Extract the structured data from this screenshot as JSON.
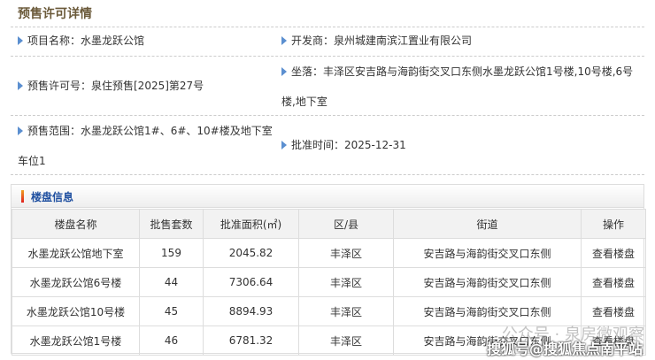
{
  "title": "预售许可详情",
  "fields": {
    "project": "项目名称：水墨龙跃公馆",
    "developer": "开发商：泉州城建南滨江置业有限公司",
    "permit": "预售许可号：泉住预售[2025]第27号",
    "location": "坐落：丰泽区安吉路与海韵街交叉口东侧水墨龙跃公馆1号楼,10号楼,6号楼,地下室",
    "scope": "预售范围：水墨龙跃公馆1#、6#、10#楼及地下室车位1",
    "approval": "批准时间：2025-12-31"
  },
  "panel_title": "楼盘信息",
  "headers": [
    "楼盘名称",
    "批售套数",
    "批准面积(㎡)",
    "区/县",
    "街道",
    "操作"
  ],
  "rows": [
    [
      "水墨龙跃公馆地下室",
      "159",
      "2045.82",
      "丰泽区",
      "安吉路与海韵街交叉口东侧",
      "查看楼盘"
    ],
    [
      "水墨龙跃公馆6号楼",
      "44",
      "7306.64",
      "丰泽区",
      "安吉路与海韵街交叉口东侧",
      "查看楼盘"
    ],
    [
      "水墨龙跃公馆10号楼",
      "45",
      "8894.93",
      "丰泽区",
      "安吉路与海韵街交叉口东侧",
      "查看楼盘"
    ],
    [
      "水墨龙跃公馆1号楼",
      "46",
      "6781.32",
      "丰泽区",
      "安吉路与海韵街交叉口东侧",
      "查看楼盘"
    ]
  ],
  "watermarks": [
    "公众号 · 泉房微观察",
    "搜狐号@搜狐焦点南平站"
  ]
}
